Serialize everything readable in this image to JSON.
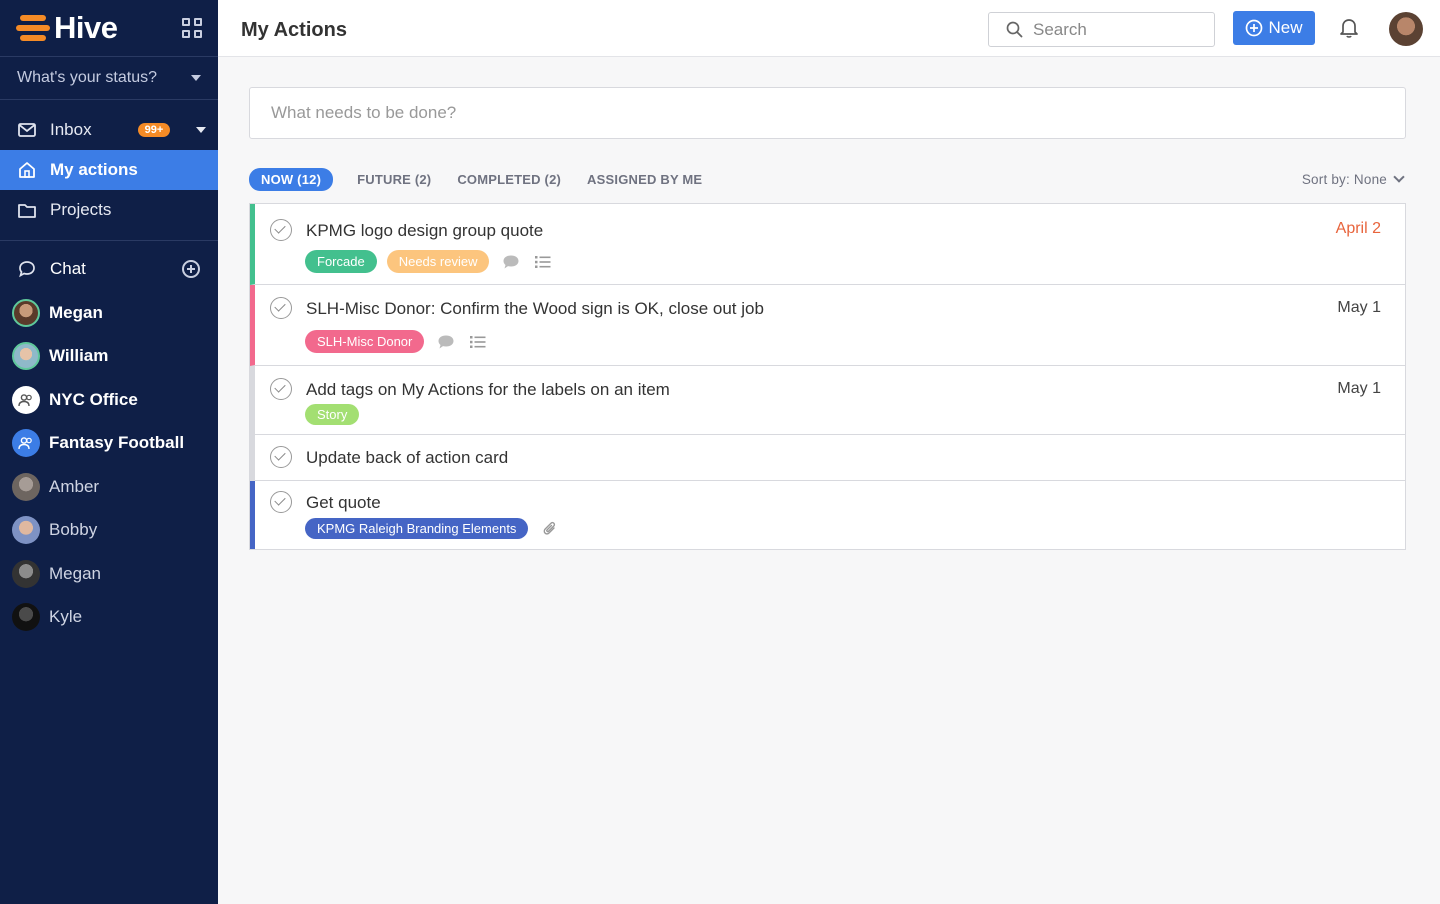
{
  "app": {
    "name": "Hive"
  },
  "sidebar": {
    "status_text": "What's your status?",
    "nav": [
      {
        "label": "Inbox",
        "badge": "99+"
      },
      {
        "label": "My actions"
      },
      {
        "label": "Projects"
      }
    ],
    "chat_label": "Chat",
    "chats": [
      {
        "label": "Megan"
      },
      {
        "label": "William"
      },
      {
        "label": "NYC Office"
      },
      {
        "label": "Fantasy Football"
      },
      {
        "label": "Amber"
      },
      {
        "label": "Bobby"
      },
      {
        "label": "Megan"
      },
      {
        "label": "Kyle"
      }
    ]
  },
  "header": {
    "title": "My Actions",
    "search_placeholder": "Search",
    "new_label": "New"
  },
  "main": {
    "input_placeholder": "What needs to be done?",
    "tabs": [
      {
        "label": "NOW (12)"
      },
      {
        "label": "FUTURE (2)"
      },
      {
        "label": "COMPLETED (2)"
      },
      {
        "label": "ASSIGNED BY ME"
      }
    ],
    "sort_label": "Sort by: None",
    "actions": [
      {
        "title": "KPMG logo design group quote",
        "date": "April 2",
        "tags": [
          "Forcade",
          "Needs review"
        ]
      },
      {
        "title": "SLH-Misc Donor: Confirm the Wood sign is OK, close out job",
        "date": "May 1",
        "tags": [
          "SLH-Misc Donor"
        ]
      },
      {
        "title": "Add tags on My Actions for the labels on an item",
        "date": "May 1",
        "tags": [
          "Story"
        ]
      },
      {
        "title": "Update back of action card",
        "date": "",
        "tags": []
      },
      {
        "title": "Get quote",
        "date": "",
        "tags": [
          "KPMG Raleigh Branding Elements"
        ]
      }
    ]
  },
  "colors": {
    "sidebar_bg": "#0f1f47",
    "accent": "#3c7de6",
    "brand_orange": "#f58b26",
    "green": "#43c08e",
    "pink": "#f2698d",
    "peach": "#fcc57e",
    "lime": "#a3df72",
    "indigo": "#4565c5",
    "date_red": "#e8643c"
  }
}
